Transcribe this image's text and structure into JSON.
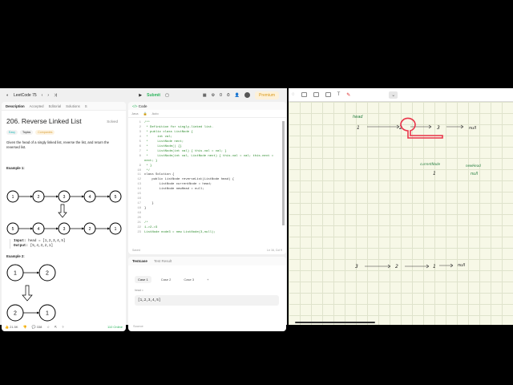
{
  "topbar": {
    "list_name": "LeetCode 75",
    "submit": "Submit",
    "coins": "0",
    "premium": "Premium"
  },
  "left": {
    "tabs": [
      "Description",
      "Accepted",
      "Editorial",
      "Solutions",
      "S"
    ],
    "title": "206. Reverse Linked List",
    "status": "Solved",
    "chips": [
      "Easy",
      "Topics",
      "Companies"
    ],
    "description": "Given the head of a singly linked list, reverse the list, and return the reversed list.",
    "example1": "Example 1:",
    "ex1_in": [
      1,
      2,
      3,
      4,
      5
    ],
    "ex1_out": [
      5,
      4,
      3,
      2,
      1
    ],
    "input_label": "Input:",
    "input_value": "head = [1,2,3,4,5]",
    "output_label": "Output:",
    "output_value": "[5,4,3,2,1]",
    "example2": "Example 2:",
    "ex2_in": [
      1,
      2
    ],
    "ex2_out": [
      2,
      1
    ],
    "likes": "21.5K",
    "comments": "338",
    "online": "110 Online"
  },
  "code": {
    "title": "Code",
    "language": "Java",
    "mode": "Auto",
    "lines": [
      "/**",
      " * Definition for singly-linked list.",
      " * public class ListNode {",
      " *     int val;",
      " *     ListNode next;",
      " *     ListNode() {}",
      " *     ListNode(int val) { this.val = val; }",
      " *     ListNode(int val, ListNode next) { this.val = val; this.next =",
      "next; }",
      " * }",
      " */",
      "class Solution {",
      "    public ListNode reverseList(ListNode head) {",
      "        ListNode currentNode = head;",
      "        ListNode newHead = null;",
      "",
      "        ",
      "    }",
      "}",
      "",
      "",
      "/*",
      "1->2->3",
      "ListNode node3 = new ListNode(3,null);"
    ],
    "line_numbers": [
      "1",
      "2",
      "3",
      "4",
      "5",
      "6",
      "7",
      "8",
      "",
      "9",
      "10",
      "11",
      "12",
      "13",
      "14",
      "15",
      "16",
      "17",
      "18",
      "19",
      "20",
      "21",
      "22",
      "23",
      "24"
    ],
    "saved": "Saved",
    "cursor": "Ln 16, Col 9"
  },
  "test": {
    "tab_testcase": "Testcase",
    "tab_result": "Test Result",
    "cases": [
      "Case 1",
      "Case 2",
      "Case 3"
    ],
    "add": "+",
    "param": "head =",
    "value": "[1,2,3,4,5]",
    "source": "Source"
  },
  "notes": {
    "head": "head",
    "row1": [
      "1",
      "2",
      "3",
      "null"
    ],
    "current_label": "currentNode",
    "current_val": "1",
    "newhead_label": "newHead",
    "newhead_val": "null",
    "row2": [
      "3",
      "2",
      "1",
      "null"
    ],
    "ink_green": "#1f7a3a",
    "highlight": "#e8203a"
  }
}
